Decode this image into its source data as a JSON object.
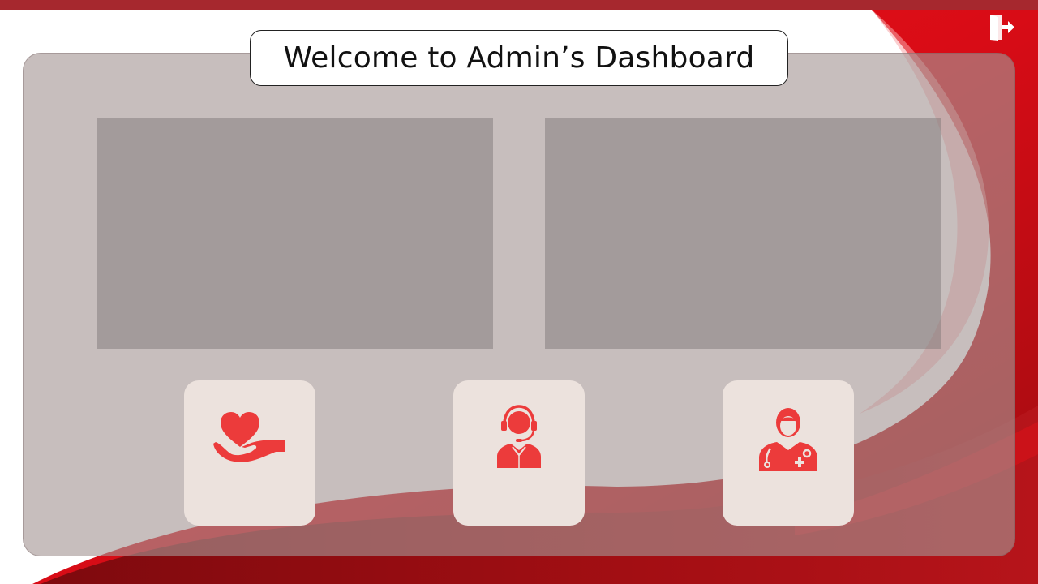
{
  "header": {
    "title": "Welcome to Admin’s Dashboard",
    "logout_icon": "logout-door-icon"
  },
  "stat_cards": [
    {
      "name": "stat-card-left",
      "content": ""
    },
    {
      "name": "stat-card-right",
      "content": ""
    }
  ],
  "nav_tiles": [
    {
      "icon": "donation-heart-hand-icon"
    },
    {
      "icon": "support-agent-headset-icon"
    },
    {
      "icon": "doctor-stethoscope-icon"
    }
  ],
  "colors": {
    "brand_red": "#e8001c",
    "dark_red": "#8e0d12",
    "icon_red": "#ec3b3b",
    "top_strip": "#a6282e",
    "tile_bg": "#ece2dd"
  }
}
